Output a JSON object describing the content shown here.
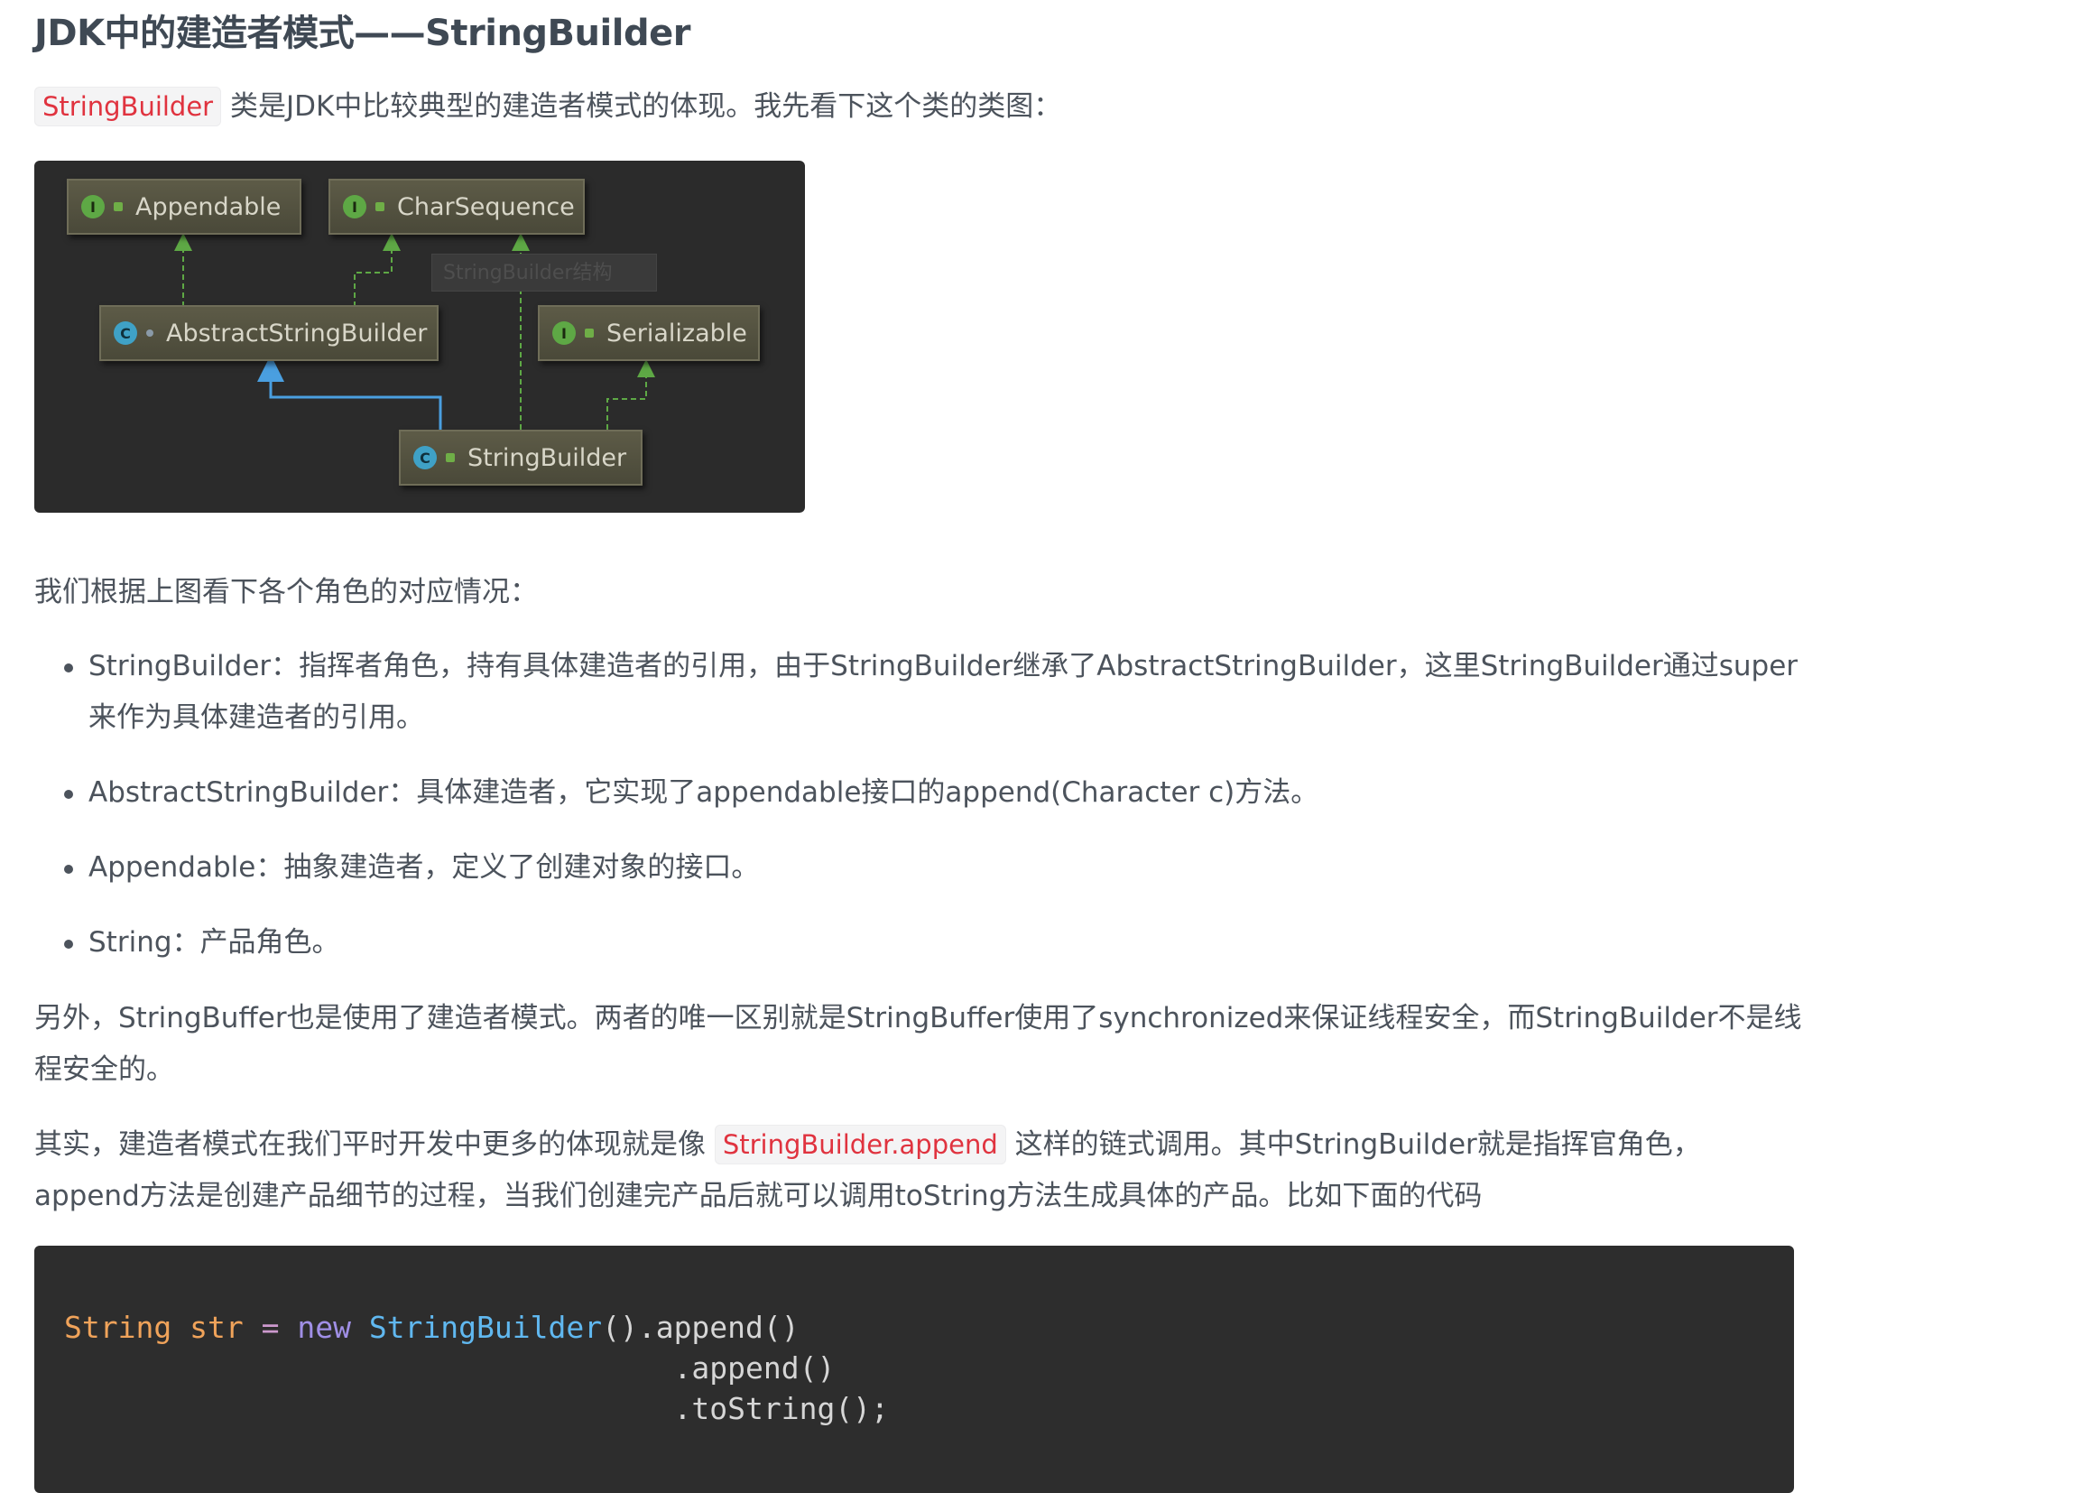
{
  "title": "JDK中的建造者模式——StringBuilder",
  "intro": {
    "code": "StringBuilder",
    "text": "类是JDK中比较典型的建造者模式的体现。我先看下这个类的类图："
  },
  "diagram": {
    "nodes": {
      "appendable": {
        "name": "Appendable",
        "icon": "I"
      },
      "charsequence": {
        "name": "CharSequence",
        "icon": "I"
      },
      "abstract": {
        "name": "AbstractStringBuilder",
        "icon": "C"
      },
      "serializable": {
        "name": "Serializable",
        "icon": "I"
      },
      "stringbuilder": {
        "name": "StringBuilder",
        "icon": "C"
      }
    },
    "ghost_label": "StringBuilder结构"
  },
  "roles_intro": "我们根据上图看下各个角色的对应情况：",
  "roles": [
    "StringBuilder：指挥者角色，持有具体建造者的引用，由于StringBuilder继承了AbstractStringBuilder，这里StringBuilder通过super来作为具体建造者的引用。",
    "AbstractStringBuilder：具体建造者，它实现了appendable接口的append(Character c)方法。",
    "Appendable：抽象建造者，定义了创建对象的接口。",
    "String：产品角色。"
  ],
  "paragraph_buffer": "另外，StringBuffer也是使用了建造者模式。两者的唯一区别就是StringBuffer使用了synchronized来保证线程安全，而StringBuilder不是线程安全的。",
  "paragraph_chain": {
    "before": "其实，建造者模式在我们平时开发中更多的体现就是像",
    "code": "StringBuilder.append",
    "after": "这样的链式调用。其中StringBuilder就是指挥官角色，append方法是创建产品细节的过程，当我们创建完产品后就可以调用toString方法生成具体的产品。比如下面的代码"
  },
  "code": {
    "type": "String",
    "var": "str",
    "op": "=",
    "kw": "new",
    "cls": "StringBuilder",
    "line1_rest": "().append()",
    "line2": "                                  .append()",
    "line3": "                                  .toString();"
  }
}
